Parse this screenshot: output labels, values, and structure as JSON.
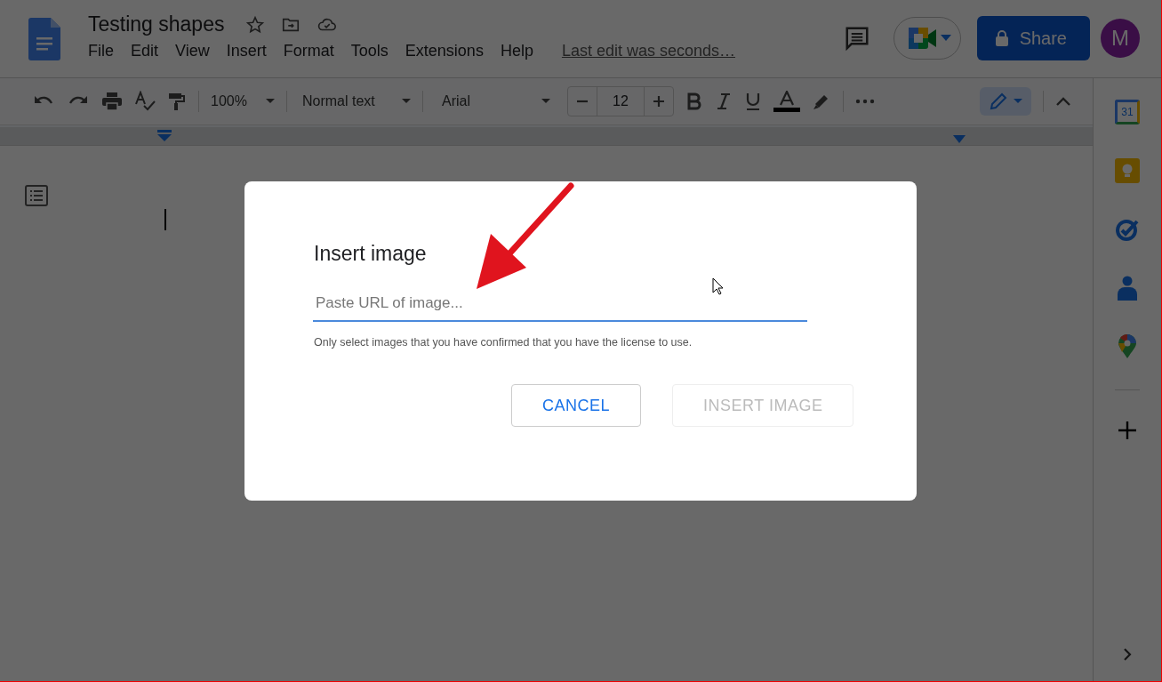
{
  "document": {
    "title": "Testing shapes",
    "last_edit": "Last edit was seconds…"
  },
  "menu": [
    "File",
    "Edit",
    "View",
    "Insert",
    "Format",
    "Tools",
    "Extensions",
    "Help"
  ],
  "share": {
    "label": "Share"
  },
  "avatar": {
    "letter": "M"
  },
  "toolbar": {
    "zoom": "100%",
    "style": "Normal text",
    "font": "Arial",
    "size": "12"
  },
  "side_panel": {
    "calendar_day": "31"
  },
  "dialog": {
    "title": "Insert image",
    "field": {
      "placeholder": "Paste URL of image..."
    },
    "note": "Only select images that you have confirmed that you have the license to use.",
    "buttons": [
      {
        "label": "CANCEL",
        "disabled": false
      },
      {
        "label": "INSERT IMAGE",
        "disabled": true
      }
    ]
  }
}
